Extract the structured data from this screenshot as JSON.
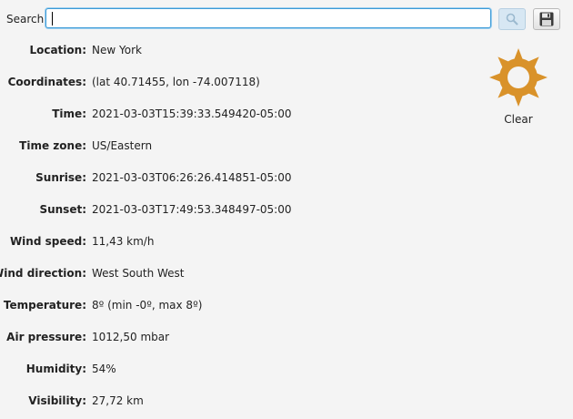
{
  "search": {
    "label": "Search:",
    "value": "",
    "placeholder": ""
  },
  "icons": {
    "search": "magnifier-icon",
    "save": "floppy-disk-icon",
    "weather": "sun-icon"
  },
  "weather": {
    "condition": "Clear",
    "icon_color": "#d9922a",
    "fields": [
      {
        "label": "Location:",
        "value": "New York"
      },
      {
        "label": "Coordinates:",
        "value": "(lat 40.71455, lon -74.007118)"
      },
      {
        "label": "Time:",
        "value": "2021-03-03T15:39:33.549420-05:00"
      },
      {
        "label": "Time zone:",
        "value": "US/Eastern"
      },
      {
        "label": "Sunrise:",
        "value": "2021-03-03T06:26:26.414851-05:00"
      },
      {
        "label": "Sunset:",
        "value": "2021-03-03T17:49:53.348497-05:00"
      },
      {
        "label": "Wind speed:",
        "value": "11,43 km/h"
      },
      {
        "label": "Wind direction:",
        "value": "West South West"
      },
      {
        "label": "Temperature:",
        "value": "8º (min -0º, max 8º)"
      },
      {
        "label": "Air pressure:",
        "value": "1012,50 mbar"
      },
      {
        "label": "Humidity:",
        "value": "54%"
      },
      {
        "label": "Visibility:",
        "value": "27,72 km"
      }
    ]
  }
}
